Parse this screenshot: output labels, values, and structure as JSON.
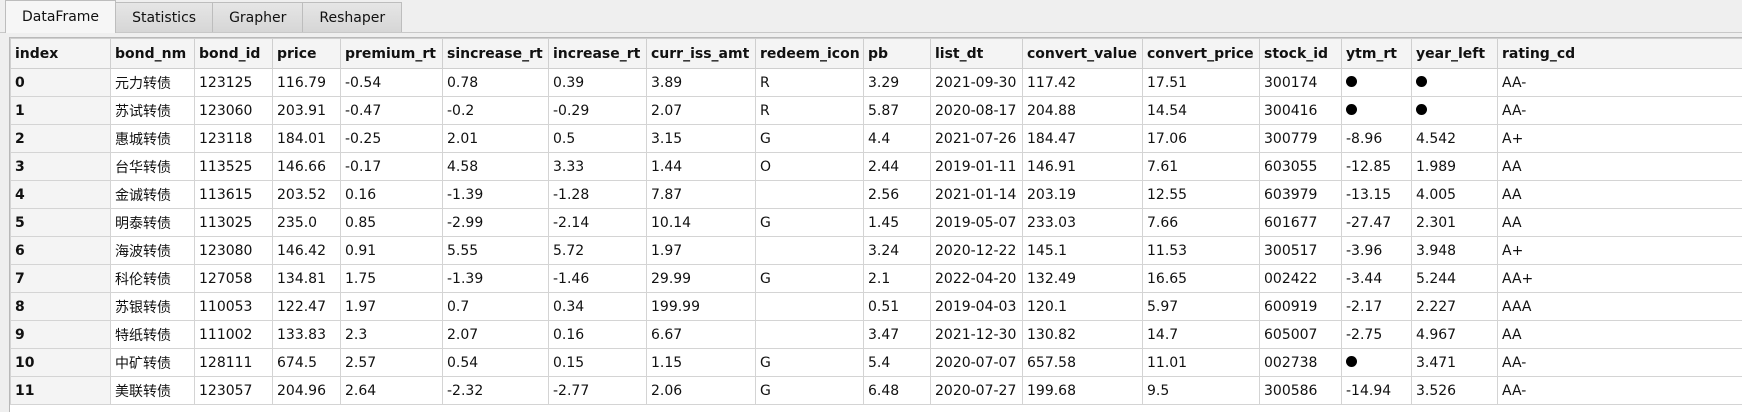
{
  "tabs": [
    {
      "label": "DataFrame",
      "active": true
    },
    {
      "label": "Statistics",
      "active": false
    },
    {
      "label": "Grapher",
      "active": false
    },
    {
      "label": "Reshaper",
      "active": false
    }
  ],
  "table": {
    "columns": [
      "index",
      "bond_nm",
      "bond_id",
      "price",
      "premium_rt",
      "sincrease_rt",
      "increase_rt",
      "curr_iss_amt",
      "redeem_icon",
      "pb",
      "list_dt",
      "convert_value",
      "convert_price",
      "stock_id",
      "ytm_rt",
      "year_left",
      "rating_cd"
    ],
    "null_marker": "●",
    "rows": [
      [
        "0",
        "元力转债",
        "123125",
        "116.79",
        "-0.54",
        "0.78",
        "0.39",
        "3.89",
        "R",
        "3.29",
        "2021-09-30",
        "117.42",
        "17.51",
        "300174",
        "●",
        "●",
        "AA-"
      ],
      [
        "1",
        "苏试转债",
        "123060",
        "203.91",
        "-0.47",
        "-0.2",
        "-0.29",
        "2.07",
        "R",
        "5.87",
        "2020-08-17",
        "204.88",
        "14.54",
        "300416",
        "●",
        "●",
        "AA-"
      ],
      [
        "2",
        "惠城转债",
        "123118",
        "184.01",
        "-0.25",
        "2.01",
        "0.5",
        "3.15",
        "G",
        "4.4",
        "2021-07-26",
        "184.47",
        "17.06",
        "300779",
        "-8.96",
        "4.542",
        "A+"
      ],
      [
        "3",
        "台华转债",
        "113525",
        "146.66",
        "-0.17",
        "4.58",
        "3.33",
        "1.44",
        "O",
        "2.44",
        "2019-01-11",
        "146.91",
        "7.61",
        "603055",
        "-12.85",
        "1.989",
        "AA"
      ],
      [
        "4",
        "金诚转债",
        "113615",
        "203.52",
        "0.16",
        "-1.39",
        "-1.28",
        "7.87",
        "",
        "2.56",
        "2021-01-14",
        "203.19",
        "12.55",
        "603979",
        "-13.15",
        "4.005",
        "AA"
      ],
      [
        "5",
        "明泰转债",
        "113025",
        "235.0",
        "0.85",
        "-2.99",
        "-2.14",
        "10.14",
        "G",
        "1.45",
        "2019-05-07",
        "233.03",
        "7.66",
        "601677",
        "-27.47",
        "2.301",
        "AA"
      ],
      [
        "6",
        "海波转债",
        "123080",
        "146.42",
        "0.91",
        "5.55",
        "5.72",
        "1.97",
        "",
        "3.24",
        "2020-12-22",
        "145.1",
        "11.53",
        "300517",
        "-3.96",
        "3.948",
        "A+"
      ],
      [
        "7",
        "科伦转债",
        "127058",
        "134.81",
        "1.75",
        "-1.39",
        "-1.46",
        "29.99",
        "G",
        "2.1",
        "2022-04-20",
        "132.49",
        "16.65",
        "002422",
        "-3.44",
        "5.244",
        "AA+"
      ],
      [
        "8",
        "苏银转债",
        "110053",
        "122.47",
        "1.97",
        "0.7",
        "0.34",
        "199.99",
        "",
        "0.51",
        "2019-04-03",
        "120.1",
        "5.97",
        "600919",
        "-2.17",
        "2.227",
        "AAA"
      ],
      [
        "9",
        "特纸转债",
        "111002",
        "133.83",
        "2.3",
        "2.07",
        "0.16",
        "6.67",
        "",
        "3.47",
        "2021-12-30",
        "130.82",
        "14.7",
        "605007",
        "-2.75",
        "4.967",
        "AA"
      ],
      [
        "10",
        "中矿转债",
        "128111",
        "674.5",
        "2.57",
        "0.54",
        "0.15",
        "1.15",
        "G",
        "5.4",
        "2020-07-07",
        "657.58",
        "11.01",
        "002738",
        "●",
        "3.471",
        "AA-"
      ],
      [
        "11",
        "美联转债",
        "123057",
        "204.96",
        "2.64",
        "-2.32",
        "-2.77",
        "2.06",
        "G",
        "6.48",
        "2020-07-27",
        "199.68",
        "9.5",
        "300586",
        "-14.94",
        "3.526",
        "AA-"
      ]
    ]
  }
}
